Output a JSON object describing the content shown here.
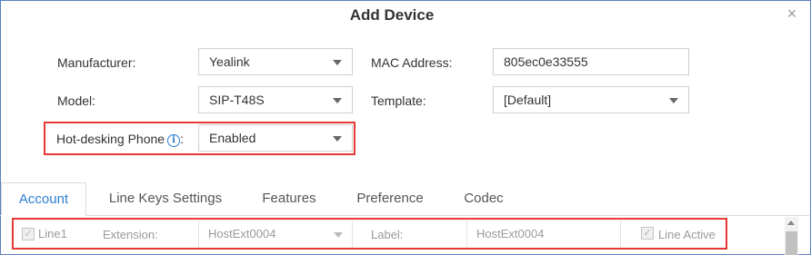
{
  "dialog": {
    "title": "Add Device",
    "close_glyph": "×"
  },
  "form": {
    "manufacturer": {
      "label": "Manufacturer:",
      "value": "Yealink"
    },
    "mac": {
      "label": "MAC Address:",
      "value": "805ec0e33555"
    },
    "model": {
      "label": "Model:",
      "value": "SIP-T48S"
    },
    "template": {
      "label": "Template:",
      "value": "[Default]"
    },
    "hotdesk": {
      "label": "Hot-desking Phone",
      "suffix": ":",
      "info_glyph": "i",
      "value": "Enabled"
    }
  },
  "tabs": [
    {
      "label": "Account",
      "active": true
    },
    {
      "label": "Line Keys Settings",
      "active": false
    },
    {
      "label": "Features",
      "active": false
    },
    {
      "label": "Preference",
      "active": false
    },
    {
      "label": "Codec",
      "active": false
    }
  ],
  "line_row": {
    "line_label": "Line1",
    "extension_label": "Extension:",
    "extension_value": "HostExt0004",
    "label_label": "Label:",
    "label_value": "HostExt0004",
    "line_active_label": "Line Active",
    "check_glyph": "✓"
  },
  "colors": {
    "accent": "#2b7fd1",
    "highlight_box": "#e53935",
    "frame_border": "#5b7fbf"
  }
}
